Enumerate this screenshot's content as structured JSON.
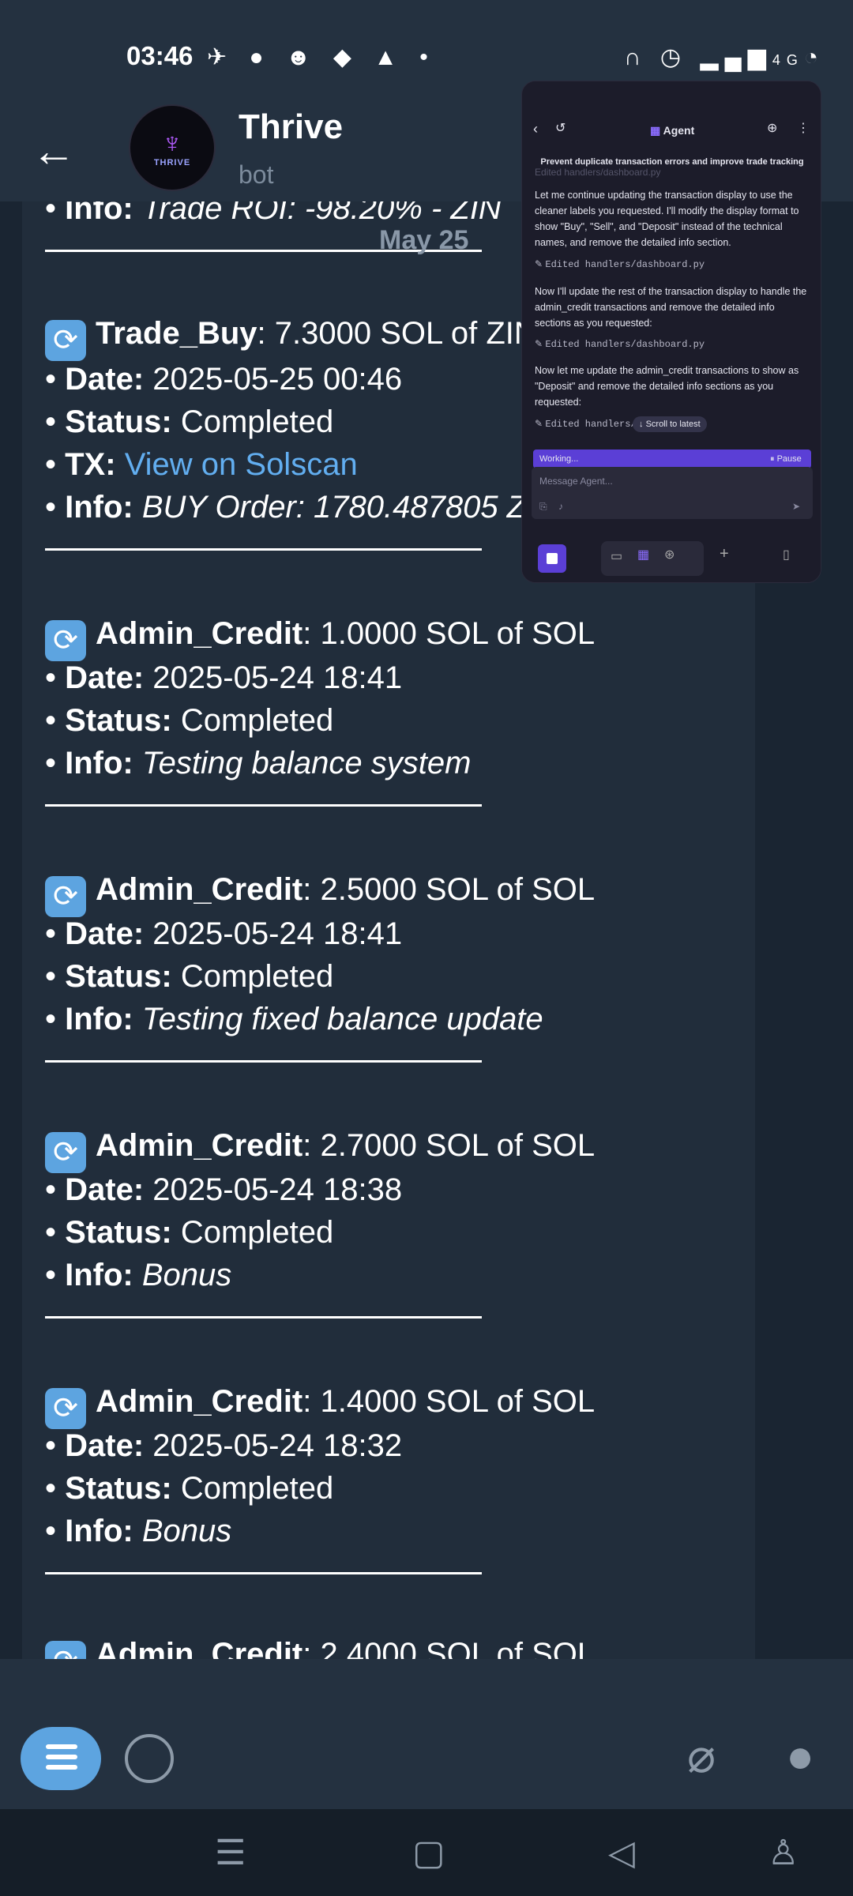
{
  "status": {
    "time": "03:46",
    "network": "4G"
  },
  "header": {
    "title": "Thrive",
    "subtitle": "bot",
    "avatar_wordmark": "THRIVE"
  },
  "date_chip": "May 25",
  "messages": {
    "partial_top": {
      "label": "Info:",
      "value": "Trade ROI: -98.20% - ZIN"
    },
    "trade_buy": {
      "type": "Trade_Buy",
      "amount": ": 7.3000 SOL of ZIN",
      "date_label": "Date:",
      "date": "2025-05-25 00:46",
      "status_label": "Status:",
      "status": "Completed",
      "tx_label": "TX:",
      "tx_link": "View on Solscan",
      "info_label": "Info:",
      "info": "BUY Order: 1780.487805 ZI"
    },
    "credit1": {
      "type": "Admin_Credit",
      "amount": ": 1.0000 SOL of SOL",
      "date_label": "Date:",
      "date": "2025-05-24 18:41",
      "status_label": "Status:",
      "status": "Completed",
      "info_label": "Info:",
      "info": "Testing balance system"
    },
    "credit2": {
      "type": "Admin_Credit",
      "amount": ": 2.5000 SOL of SOL",
      "date_label": "Date:",
      "date": "2025-05-24 18:41",
      "status_label": "Status:",
      "status": "Completed",
      "info_label": "Info:",
      "info": "Testing fixed balance update"
    },
    "credit3": {
      "type": "Admin_Credit",
      "amount": ": 2.7000 SOL of SOL",
      "date_label": "Date:",
      "date": "2025-05-24 18:38",
      "status_label": "Status:",
      "status": "Completed",
      "info_label": "Info:",
      "info": "Bonus"
    },
    "credit4": {
      "type": "Admin_Credit",
      "amount": ": 1.4000 SOL of SOL",
      "date_label": "Date:",
      "date": "2025-05-24 18:32",
      "status_label": "Status:",
      "status": "Completed",
      "info_label": "Info:",
      "info": "Bonus"
    },
    "partial_bottom": {
      "type": "Admin_Credit",
      "amount": ": 2.4000 SOL of SOL"
    }
  },
  "agent": {
    "title": "Agent",
    "task": "Prevent duplicate transaction errors and improve trade tracking",
    "edited_partial": "Edited handlers/dashboard.py",
    "para1": "Let me continue updating the transaction display to use the cleaner labels you requested. I'll modify the display format to show \"Buy\", \"Sell\", and \"Deposit\" instead of the technical names, and remove the detailed info section.",
    "edit1": "Edited handlers/dashboard.py",
    "para2": "Now I'll update the rest of the transaction display to handle the admin_credit transactions and remove the detailed info sections as you requested:",
    "edit2": "Edited handlers/dashboard.py",
    "para3": "Now let me update the admin_credit transactions to show as \"Deposit\" and remove the detailed info sections as you requested:",
    "edit3": "Edited handlers/",
    "scroll_latest": "Scroll to latest",
    "working": "Working...",
    "pause": "Pause",
    "message_placeholder": "Message Agent..."
  },
  "colors": {
    "accent": "#5da4e0",
    "link": "#62aef0",
    "agent_purple": "#5b3fd6",
    "bg": "#1b2633"
  }
}
